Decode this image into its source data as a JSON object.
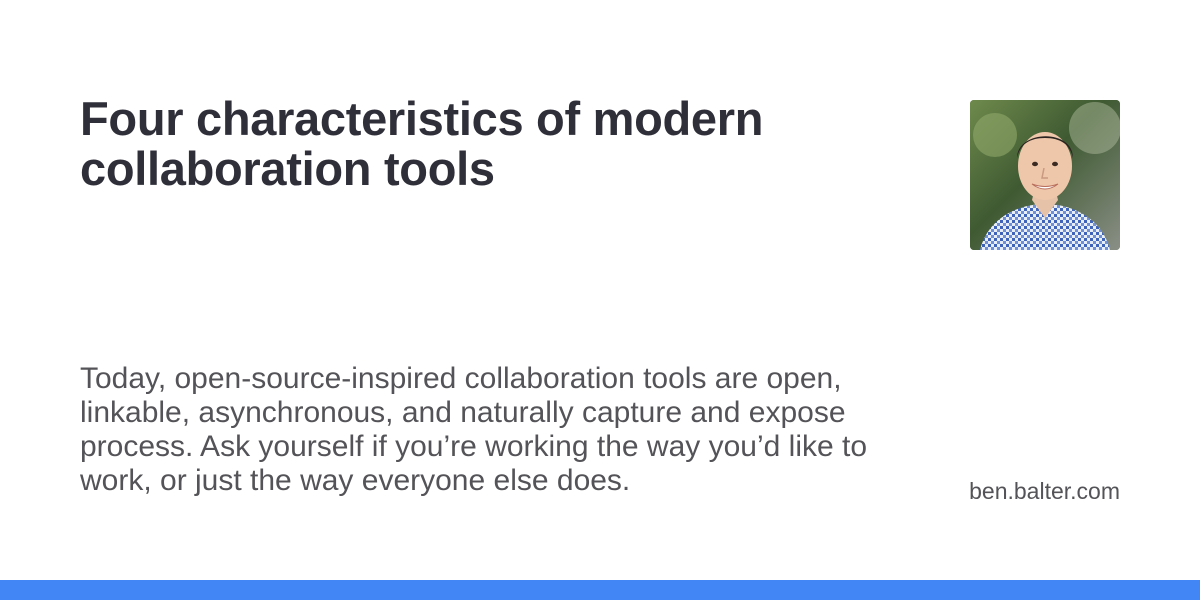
{
  "title": "Four characteristics of modern collaboration tools",
  "description": "Today, open-source-inspired collaboration tools are open, linkable, asynchronous, and naturally capture and expose process. Ask yourself if you’re working the way you’d like to work, or just the way everyone else does.",
  "domain": "ben.balter.com",
  "avatar": {
    "icon": "author-photo"
  },
  "colors": {
    "accent_bar": "#4285f4",
    "title": "#2f2f3a",
    "body_text": "#545458"
  }
}
